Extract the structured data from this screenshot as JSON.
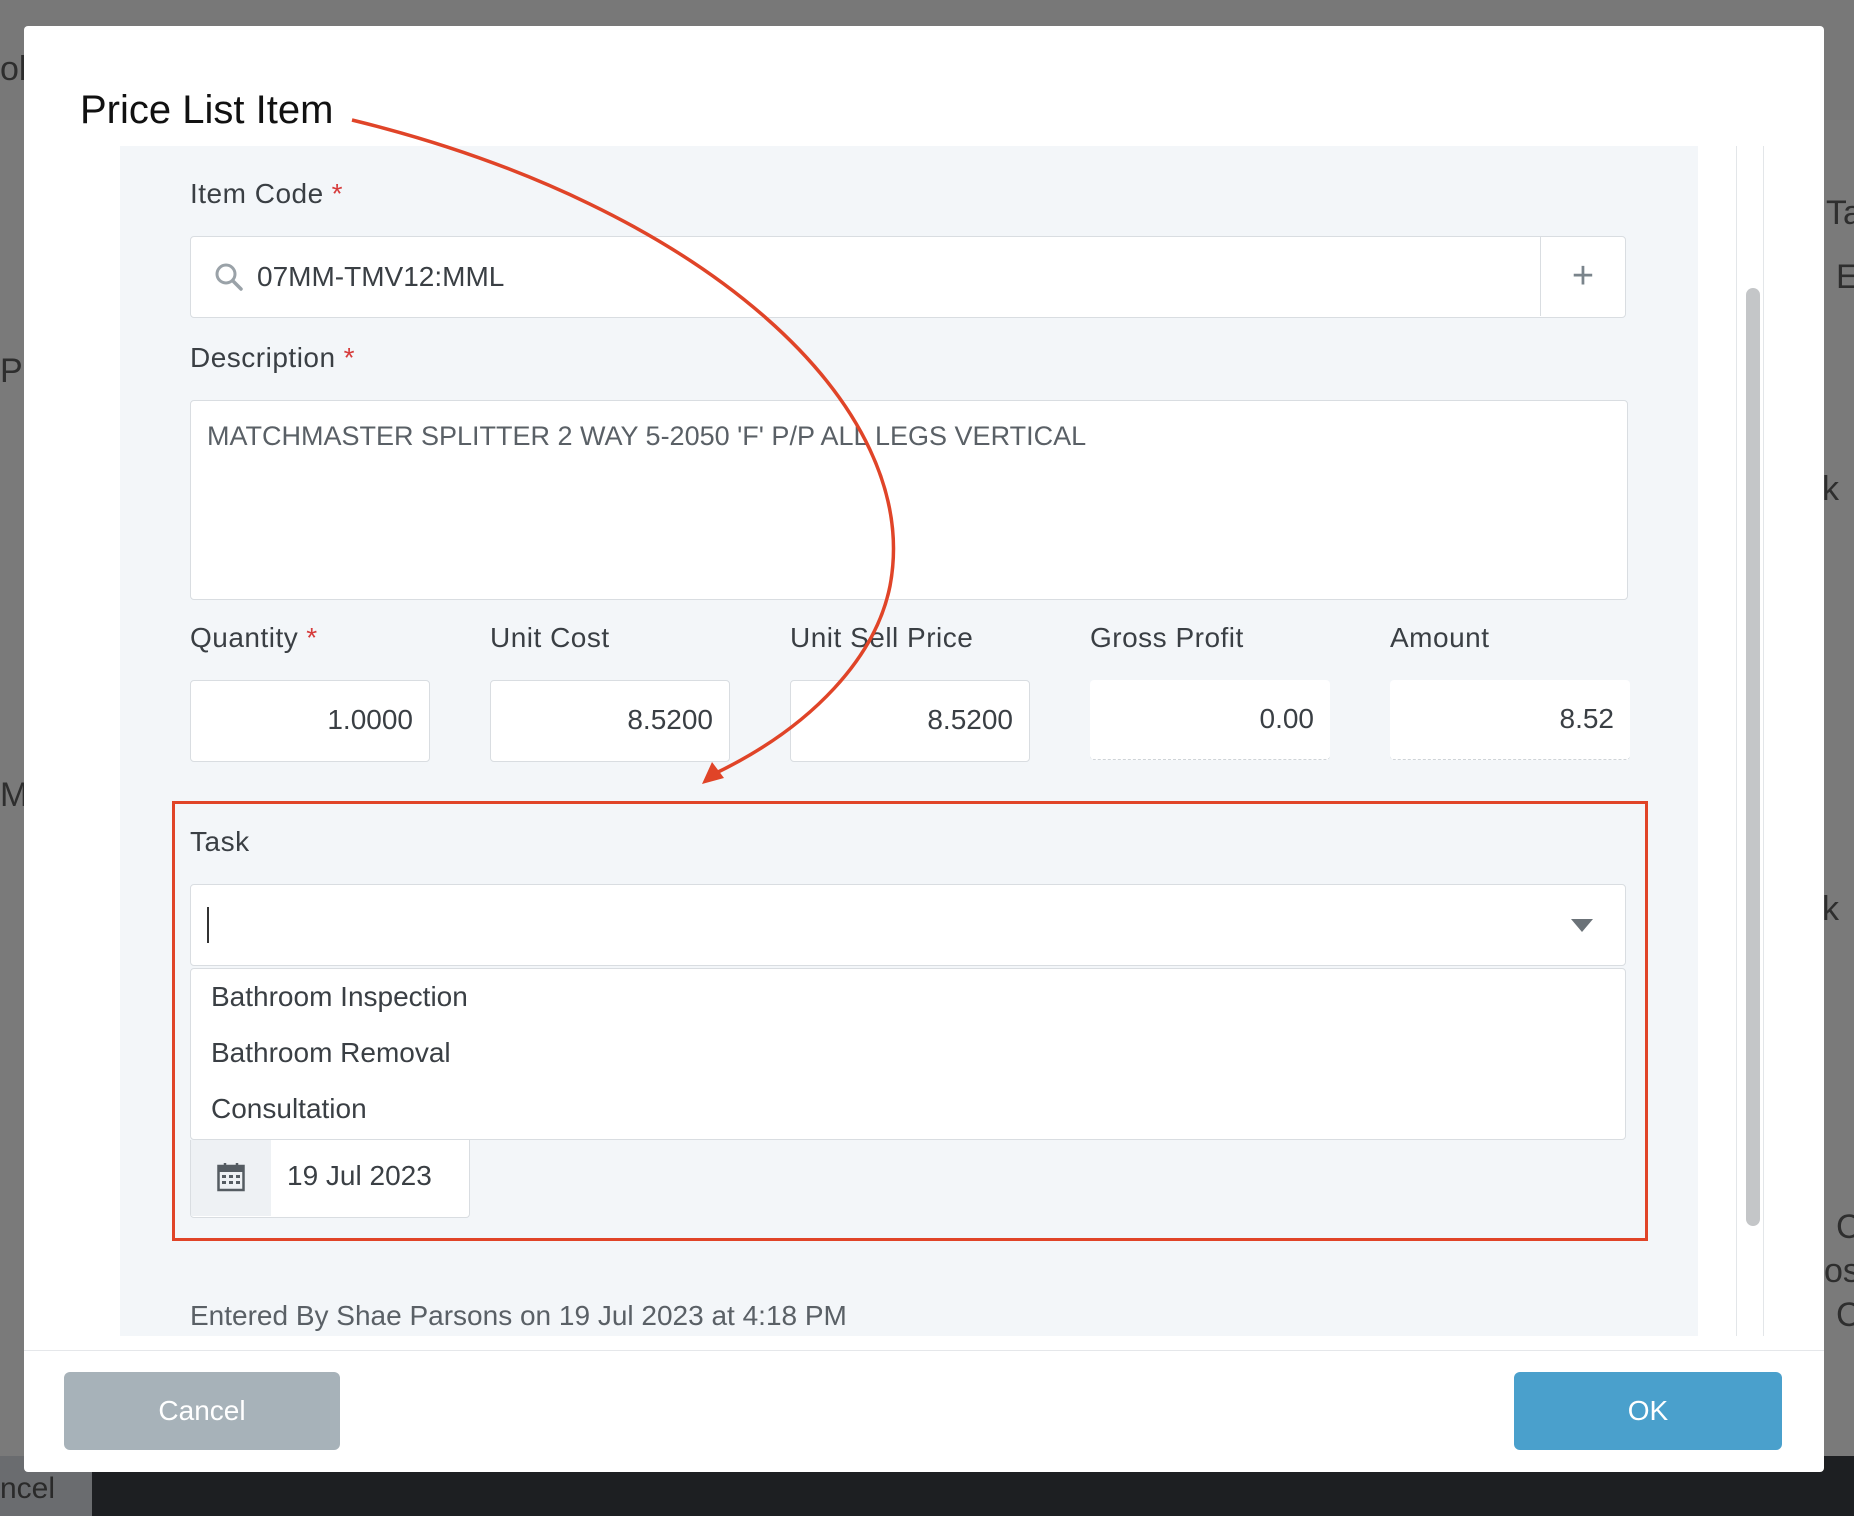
{
  "modal": {
    "title": "Price List Item"
  },
  "form": {
    "item_code": {
      "label": "Item Code",
      "required_mark": "*",
      "value": "07MM-TMV12:MML",
      "add_glyph": "+"
    },
    "description": {
      "label": "Description",
      "required_mark": "*",
      "value": "MATCHMASTER SPLITTER 2 WAY 5-2050 'F' P/P ALL LEGS VERTICAL"
    },
    "quantity": {
      "label": "Quantity",
      "required_mark": "*",
      "value": "1.0000"
    },
    "unit_cost": {
      "label": "Unit Cost",
      "value": "8.5200"
    },
    "unit_sell_price": {
      "label": "Unit Sell Price",
      "value": "8.5200"
    },
    "gross_profit": {
      "label": "Gross Profit",
      "value": "0.00"
    },
    "amount": {
      "label": "Amount",
      "value": "8.52"
    },
    "task": {
      "label": "Task",
      "value": "",
      "options": [
        "Bathroom Inspection",
        "Bathroom Removal",
        "Consultation"
      ]
    },
    "date": {
      "value": "19 Jul 2023"
    },
    "entered_by": "Entered By Shae Parsons on 19 Jul 2023 at 4:18 PM"
  },
  "buttons": {
    "cancel": "Cancel",
    "ok": "OK"
  },
  "background": {
    "left_fragments": [
      "ob",
      "Pr",
      "M"
    ],
    "right_fragments": [
      "Ta",
      "E",
      "k",
      "k",
      "C",
      "os",
      "C"
    ],
    "bottom_left": "ncel"
  },
  "colors": {
    "ok_button": "#4aa0cc",
    "cancel_button": "#a7b2b9",
    "annotation": "#e04428",
    "required": "#d63b3b",
    "form_background": "#f3f6f9"
  },
  "icons": {
    "search": "magnifier-icon",
    "add": "plus-icon",
    "dropdown": "triangle-down-icon",
    "calendar": "calendar-icon"
  }
}
